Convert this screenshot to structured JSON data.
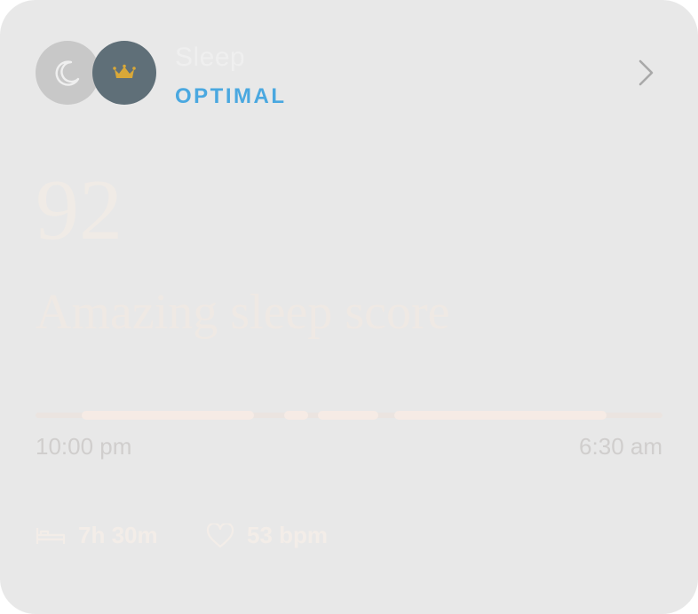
{
  "card": {
    "title": "Sleep",
    "status": "OPTIMAL",
    "score": "92",
    "score_description": "Amazing sleep score",
    "time_start": "10:00 pm",
    "time_end": "6:30 am",
    "stats": {
      "duration": "7h 30m",
      "heart_rate": "53 bpm"
    },
    "icons": {
      "primary": "moon-icon",
      "badge": "crown-icon",
      "navigate": "chevron-right-icon",
      "duration": "bed-icon",
      "heart_rate": "heart-icon"
    },
    "colors": {
      "status": "#4aa8e0",
      "badge_bg": "#5f6f78",
      "crown": "#d9a838",
      "card_bg": "#e8e8e8"
    }
  }
}
